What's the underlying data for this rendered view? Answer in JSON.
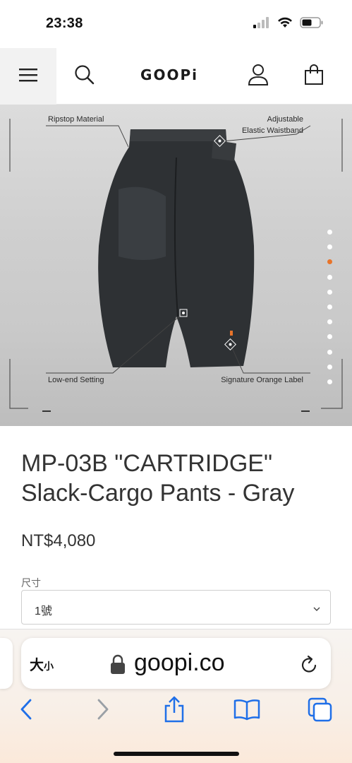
{
  "status_bar": {
    "time": "23:38"
  },
  "header": {
    "brand": "GOOPi",
    "icons": [
      "hamburger-menu-icon",
      "search-icon",
      "user-icon",
      "shopping-bag-icon"
    ]
  },
  "hero": {
    "labels": {
      "ripstop": "Ripstop Material",
      "waistband_line1": "Adjustable",
      "waistband_line2": "Elastic Waistband",
      "low_end": "Low-end Setting",
      "orange_label": "Signature Orange Label"
    },
    "carousel": {
      "total": 11,
      "active_index": 2,
      "active_color": "#e8742a"
    }
  },
  "product": {
    "title_line1": "MP-03B \"CARTRIDGE\"",
    "title_line2": "Slack-Cargo Pants - Gray",
    "price": "NT$4,080",
    "size_label": "尺寸",
    "size_value": "1號"
  },
  "browser": {
    "text_size_big": "大",
    "text_size_small": "小",
    "url": "goopi.co",
    "nav_icons": [
      "back-icon",
      "forward-icon",
      "share-icon",
      "bookmarks-icon",
      "tabs-icon"
    ]
  }
}
